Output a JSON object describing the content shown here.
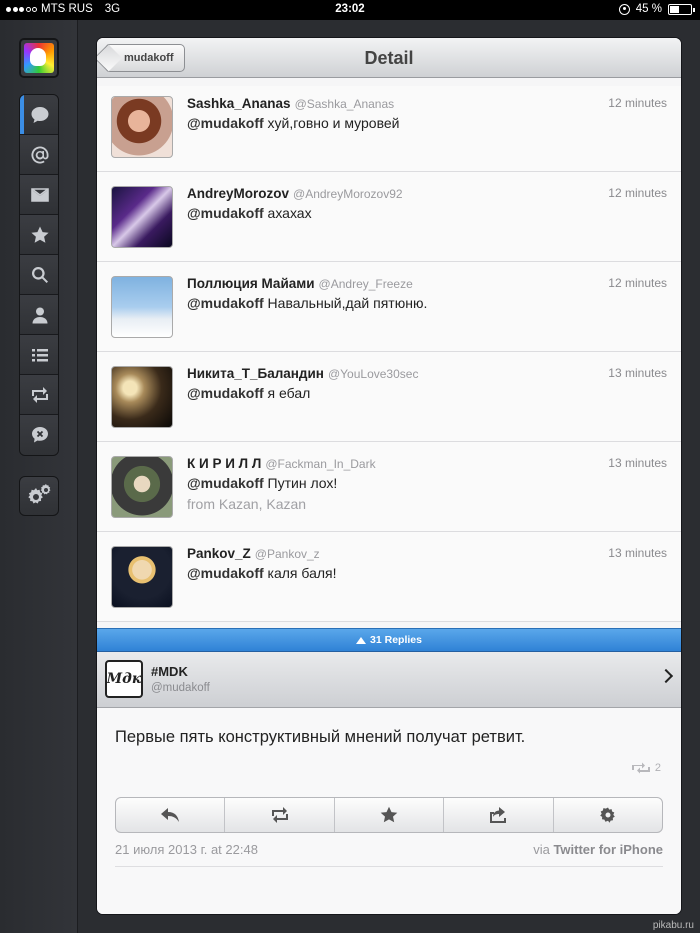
{
  "status_bar": {
    "carrier": "MTS RUS",
    "network": "3G",
    "time": "23:02",
    "battery": "45 %",
    "battery_level": 0.45
  },
  "sidebar": {
    "nav_items": [
      {
        "icon": "speech-bubble-icon",
        "active": true
      },
      {
        "icon": "at-sign-icon",
        "active": false
      },
      {
        "icon": "envelope-icon",
        "active": false
      },
      {
        "icon": "star-icon",
        "active": false
      },
      {
        "icon": "search-icon",
        "active": false
      },
      {
        "icon": "person-icon",
        "active": false
      },
      {
        "icon": "list-icon",
        "active": false
      },
      {
        "icon": "retweet-icon",
        "active": false
      },
      {
        "icon": "mute-icon",
        "active": false
      }
    ],
    "settings_icon": "gears-icon"
  },
  "navbar": {
    "back_label": "mudakoff",
    "title": "Detail"
  },
  "replies": [
    {
      "name": "Sashka_Ananas",
      "handle": "@Sashka_Ananas",
      "time": "12 minutes",
      "mention": "@mudakoff",
      "text": "хуй,говно и муровей",
      "location": ""
    },
    {
      "name": "AndreyMorozov",
      "handle": "@AndreyMorozov92",
      "time": "12 minutes",
      "mention": "@mudakoff",
      "text": "ахахах",
      "location": ""
    },
    {
      "name": "Поллюция Майами",
      "handle": "@Andrey_Freeze",
      "time": "12 minutes",
      "mention": "@mudakoff",
      "text": "Навальный,дай пятюню.",
      "location": ""
    },
    {
      "name": "Никита_Т_Баландин",
      "handle": "@YouLove30sec",
      "time": "13 minutes",
      "mention": "@mudakoff",
      "text": "я ебал",
      "location": ""
    },
    {
      "name": "К И Р И Л Л",
      "handle": "@Fackman_In_Dark",
      "time": "13 minutes",
      "mention": "@mudakoff",
      "text": "Путин лох!",
      "location": "from Kazan, Kazan"
    },
    {
      "name": "Pankov_Z",
      "handle": "@Pankov_z",
      "time": "13 minutes",
      "mention": "@mudakoff",
      "text": "каля баля!",
      "location": ""
    }
  ],
  "replies_bar": {
    "label": "31 Replies"
  },
  "tweet": {
    "author_name": "#MDK",
    "author_handle": "@mudakoff",
    "logo_text": "Mдк",
    "text": "Первые пять конструктивный мнений получат ретвит.",
    "retweet_count": "2",
    "date": "21 июля 2013 г. at 22:48",
    "via_prefix": "via",
    "via_client": "Twitter for iPhone",
    "actions": [
      "reply-icon",
      "retweet-icon",
      "favorite-star-icon",
      "share-icon",
      "gear-icon"
    ]
  },
  "watermark": "pikabu.ru",
  "colors": {
    "accent_blue": "#3b8ee6",
    "sidebar_bg": "#2b2d31"
  }
}
